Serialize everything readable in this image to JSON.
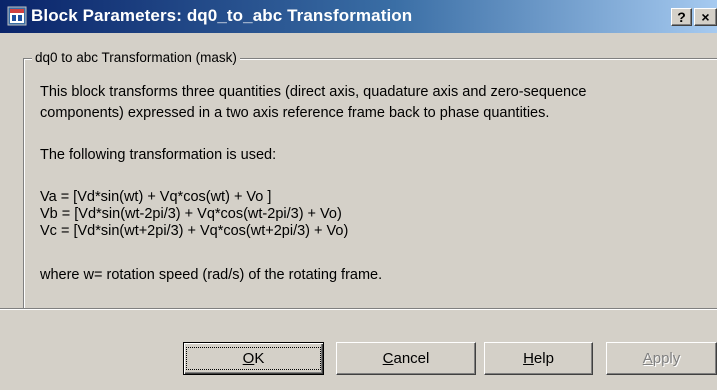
{
  "window": {
    "title": "Block Parameters: dq0_to_abc Transformation",
    "help_label": "?",
    "close_label": "×"
  },
  "group": {
    "legend": "dq0 to abc Transformation (mask)"
  },
  "description": {
    "line1": "This block transforms  three quantities  (direct axis, quadature axis and zero-sequence",
    "line2": "components)  expressed in a two axis reference frame back to phase quantities.",
    "line3": "The following transformation is used:",
    "equations": [
      "Va = [Vd*sin(wt) +  Vq*cos(wt)  +  Vo ]",
      "Vb = [Vd*sin(wt-2pi/3)  + Vq*cos(wt-2pi/3)  + Vo)",
      "Vc = [Vd*sin(wt+2pi/3) + Vq*cos(wt+2pi/3)  + Vo)"
    ],
    "line4": "where w=  rotation speed (rad/s) of the rotating frame."
  },
  "buttons": {
    "ok": {
      "mnemonic": "O",
      "rest": "K"
    },
    "cancel": {
      "mnemonic": "C",
      "rest": "ancel"
    },
    "help": {
      "mnemonic": "H",
      "rest": "elp"
    },
    "apply": {
      "mnemonic": "A",
      "rest": "pply"
    }
  },
  "colors": {
    "titlebar_start": "#0a246a",
    "titlebar_end": "#a6caf0",
    "face": "#d4d0c8",
    "disabled_text": "#808080"
  },
  "icons": {
    "app": "simulink-block-icon"
  }
}
